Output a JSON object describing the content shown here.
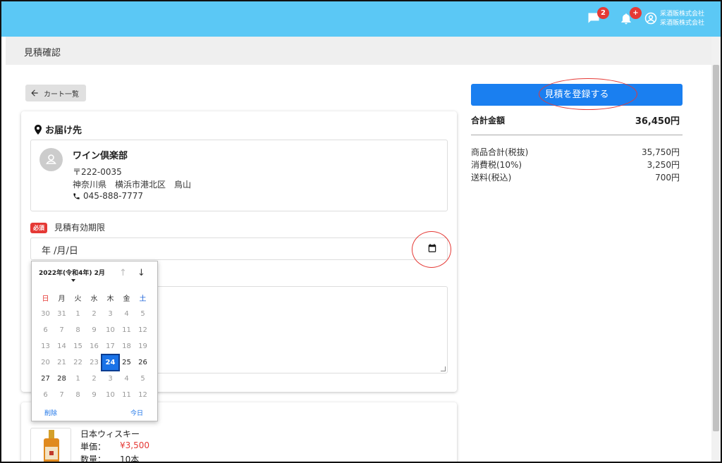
{
  "header": {
    "chat_badge": "2",
    "notify_badge": "+",
    "company_line1": "采酒販株式会社",
    "company_line2": "采酒販株式会社"
  },
  "page_title": "見積確認",
  "back_button": "カート一覧",
  "delivery": {
    "section_title": "お届け先",
    "name": "ワイン倶楽部",
    "postal": "〒222-0035",
    "address": "神奈川県　横浜市港北区　鳥山",
    "phone": "045-888-7777"
  },
  "expiry": {
    "required_badge": "必須",
    "label": "見積有効期限",
    "placeholder": "年 /月/日"
  },
  "calendar": {
    "month_label": "2022年(令和4年) 2月",
    "weekdays": [
      "日",
      "月",
      "火",
      "水",
      "木",
      "金",
      "土"
    ],
    "weeks": [
      [
        "30",
        "31",
        "1",
        "2",
        "3",
        "4",
        "5"
      ],
      [
        "6",
        "7",
        "8",
        "9",
        "10",
        "11",
        "12"
      ],
      [
        "13",
        "14",
        "15",
        "16",
        "17",
        "18",
        "19"
      ],
      [
        "20",
        "21",
        "22",
        "23",
        "24",
        "25",
        "26"
      ],
      [
        "27",
        "28",
        "1",
        "2",
        "3",
        "4",
        "5"
      ],
      [
        "6",
        "7",
        "8",
        "9",
        "10",
        "11",
        "12"
      ]
    ],
    "today": "24",
    "clear_label": "削除",
    "today_label": "今日"
  },
  "product": {
    "name": "日本ウィスキー",
    "price_label": "単価：",
    "price_value": "¥3,500",
    "qty_label": "数量：",
    "qty_value": "10本"
  },
  "summary": {
    "register_button": "見積を登録する",
    "total_label": "合計金額",
    "total_value": "36,450円",
    "rows": [
      {
        "label": "商品合計(税抜)",
        "value": "35,750円"
      },
      {
        "label": "消費税(10%)",
        "value": "3,250円"
      },
      {
        "label": "送料(税込)",
        "value": "700円"
      }
    ]
  },
  "colors": {
    "topbar": "#5bc8f5",
    "primary": "#1a7ff0",
    "badge": "#e53935"
  }
}
